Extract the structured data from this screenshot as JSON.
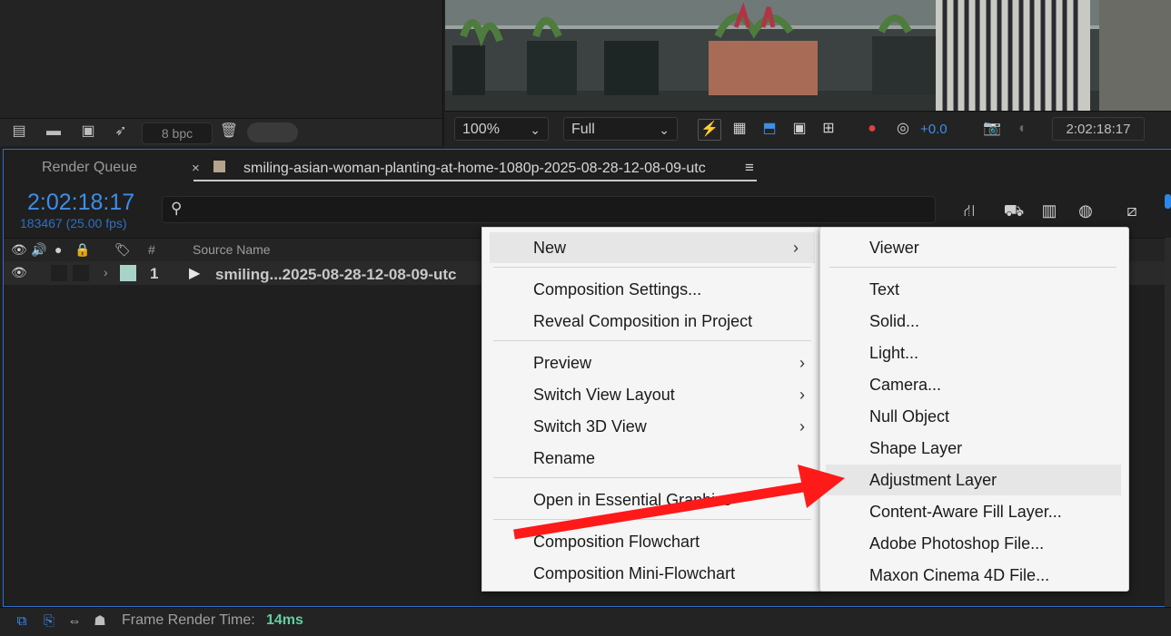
{
  "project_panel": {
    "bpc_label": "8 bpc"
  },
  "viewer": {
    "zoom": "100%",
    "resolution": "Full",
    "exposure": "+0.0",
    "time": "2:02:18:17"
  },
  "timeline": {
    "tabs": {
      "render_queue": "Render Queue",
      "close": "×",
      "comp_name": "smiling-asian-woman-planting-at-home-1080p-2025-08-28-12-08-09-utc",
      "menu": "≡"
    },
    "timecode": "2:02:18:17",
    "frame_info": "183467 (25.00 fps)",
    "columns": {
      "number": "#",
      "source_name": "Source Name"
    },
    "layer": {
      "number": "1",
      "name": "smiling...2025-08-28-12-08-09-utc"
    }
  },
  "status_bar": {
    "render_label": "Frame Render Time:",
    "render_value": "14ms"
  },
  "context_menu": {
    "items": [
      {
        "label": "New"
      },
      {
        "label": "Composition Settings..."
      },
      {
        "label": "Reveal Composition in Project"
      },
      {
        "label": "Preview"
      },
      {
        "label": "Switch View Layout"
      },
      {
        "label": "Switch 3D View"
      },
      {
        "label": "Rename"
      },
      {
        "label": "Open in Essential Graphics"
      },
      {
        "label": "Composition Flowchart"
      },
      {
        "label": "Composition Mini-Flowchart"
      }
    ],
    "submenu_arrow": "›"
  },
  "new_submenu": {
    "items": [
      {
        "label": "Viewer"
      },
      {
        "label": "Text"
      },
      {
        "label": "Solid..."
      },
      {
        "label": "Light..."
      },
      {
        "label": "Camera..."
      },
      {
        "label": "Null Object"
      },
      {
        "label": "Shape Layer"
      },
      {
        "label": "Adjustment Layer"
      },
      {
        "label": "Content-Aware Fill Layer..."
      },
      {
        "label": "Adobe Photoshop File..."
      },
      {
        "label": "Maxon Cinema 4D File..."
      }
    ],
    "highlighted": "Adjustment Layer"
  },
  "annotation": {
    "arrow_color": "#ff1a1a"
  }
}
